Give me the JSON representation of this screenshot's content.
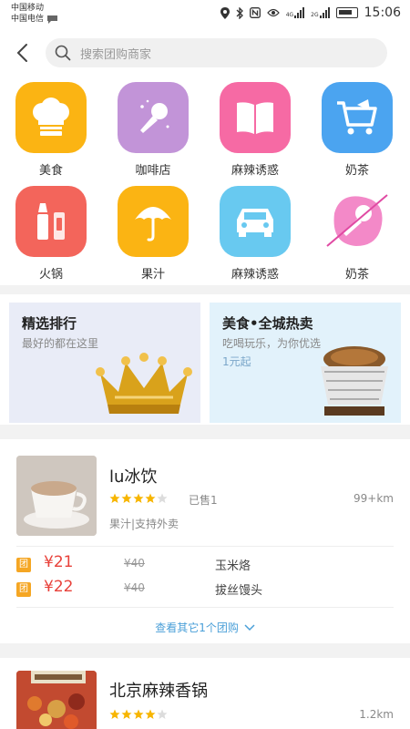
{
  "status": {
    "carrier1": "中国移动",
    "carrier2": "中国电信",
    "net1": "4G",
    "net2": "2G",
    "time": "15:06"
  },
  "search": {
    "placeholder": "搜索团购商家"
  },
  "categories": [
    {
      "label": "美食",
      "icon": "chef-hat-icon",
      "color": "#fbb413"
    },
    {
      "label": "咖啡店",
      "icon": "microphone-icon",
      "color": "#c294d8"
    },
    {
      "label": "麻辣诱惑",
      "icon": "book-icon",
      "color": "#f66aa4"
    },
    {
      "label": "奶茶",
      "icon": "shopping-cart-icon",
      "color": "#4ba4f0"
    },
    {
      "label": "火锅",
      "icon": "cosmetics-icon",
      "color": "#f3655b"
    },
    {
      "label": "果汁",
      "icon": "umbrella-icon",
      "color": "#fbb413"
    },
    {
      "label": "麻辣诱惑",
      "icon": "car-icon",
      "color": "#68c9f0"
    },
    {
      "label": "奶茶",
      "icon": "microphone-icon",
      "color": "#f389c8"
    }
  ],
  "promos": [
    {
      "title": "精选排行",
      "subtitle": "最好的都在这里",
      "extra": "",
      "bg": "#e9ecf7"
    },
    {
      "title": "美食•全城热卖",
      "subtitle": "吃喝玩乐，为你优选",
      "extra": "1元起",
      "bg": "#e2f2fb"
    }
  ],
  "shops": [
    {
      "name": "lu冰饮",
      "rating": 4,
      "sold": "已售1",
      "distance": "99+km",
      "tags": "果汁|支持外卖",
      "deals": [
        {
          "badge": "团",
          "price": "¥21",
          "original": "¥40",
          "name": "玉米烙"
        },
        {
          "badge": "团",
          "price": "¥22",
          "original": "¥40",
          "name": "拔丝馒头"
        }
      ],
      "more": "查看其它1个团购"
    },
    {
      "name": "北京麻辣香锅",
      "rating": 4,
      "distance": "1.2km"
    }
  ],
  "colors": {
    "accent": "#4a9fd8",
    "price": "#e8413a",
    "badge": "#f5a623",
    "star": "#f7b500"
  }
}
